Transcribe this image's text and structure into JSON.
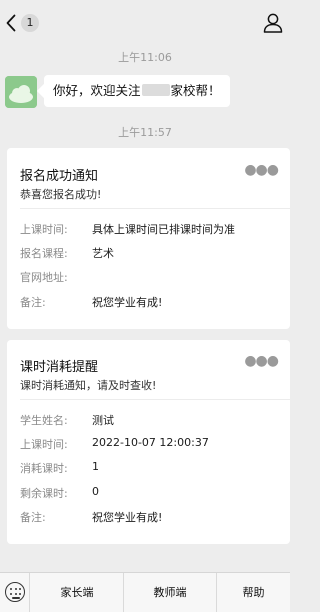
{
  "header": {
    "unread_count": "1",
    "title": ""
  },
  "timestamps": {
    "first": "上午11:06",
    "second": "上午11:57"
  },
  "welcome_message": {
    "prefix": "你好，欢迎关注",
    "suffix": "家校帮！"
  },
  "cards": [
    {
      "title": "报名成功通知",
      "subtitle": "恭喜您报名成功!",
      "rows": [
        {
          "key": "上课时间:",
          "value": "具体上课时间已排课时间为准"
        },
        {
          "key": "报名课程:",
          "value": "艺术"
        },
        {
          "key": "官网地址:",
          "value": ""
        },
        {
          "key": "备注:",
          "value": "祝您学业有成!"
        }
      ]
    },
    {
      "title": "课时消耗提醒",
      "subtitle": "课时消耗通知，请及时查收!",
      "rows": [
        {
          "key": "学生姓名:",
          "value": "测试"
        },
        {
          "key": "上课时间:",
          "value": "2022-10-07 12:00:37"
        },
        {
          "key": "消耗课时:",
          "value": "1"
        },
        {
          "key": "剩余课时:",
          "value": "0"
        },
        {
          "key": "备注:",
          "value": "祝您学业有成!"
        }
      ]
    }
  ],
  "menu": {
    "items": [
      "家长端",
      "教师端",
      "帮助"
    ]
  },
  "icons": {
    "back": "chevron-left-icon",
    "profile": "person-icon",
    "more": "ellipsis-icon",
    "keyboard": "keyboard-icon"
  },
  "colors": {
    "background": "#ededed",
    "card": "#ffffff",
    "muted_text": "#8a8a8a",
    "timestamp": "#9b9b9b"
  }
}
